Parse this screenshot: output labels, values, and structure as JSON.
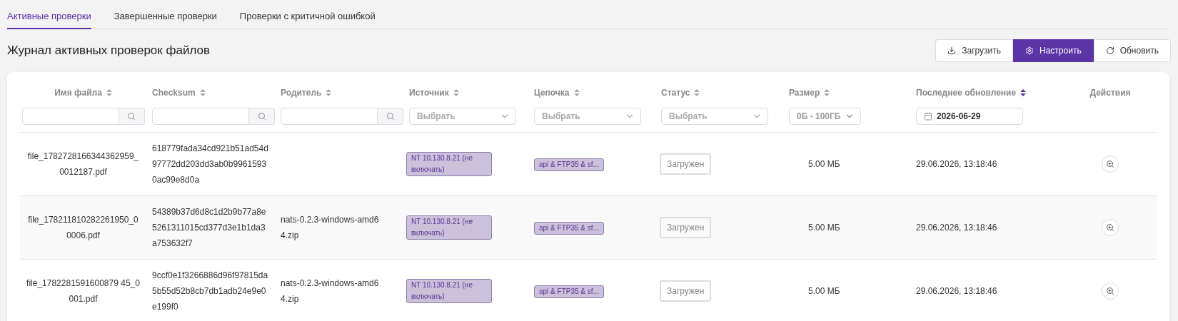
{
  "tabs": [
    {
      "label": "Активные проверки",
      "selected": true
    },
    {
      "label": "Завершенные проверки",
      "selected": false
    },
    {
      "label": "Проверки с критичной ошибкой",
      "selected": false
    }
  ],
  "title": "Журнал активных проверок файлов",
  "buttons": [
    {
      "label": "Загрузить",
      "kind": "download",
      "primary": false
    },
    {
      "label": "Настроить",
      "kind": "settings",
      "primary": true
    },
    {
      "label": "Обновить",
      "kind": "refresh",
      "primary": false
    }
  ],
  "table": {
    "columns": [
      {
        "label": "Имя файла",
        "sorted": false,
        "filter": {
          "kind": "search"
        }
      },
      {
        "label": "Checksum",
        "sorted": false,
        "filter": {
          "kind": "search"
        }
      },
      {
        "label": "Родитель",
        "sorted": false,
        "filter": {
          "kind": "search"
        }
      },
      {
        "label": "Источник",
        "sorted": false,
        "filter": {
          "kind": "select",
          "placeholder": "Выбрать"
        }
      },
      {
        "label": "Цепочка",
        "sorted": false,
        "filter": {
          "kind": "select",
          "placeholder": "Выбрать"
        }
      },
      {
        "label": "Статус",
        "sorted": false,
        "filter": {
          "kind": "select",
          "placeholder": "Выбрать"
        }
      },
      {
        "label": "Размер",
        "sorted": false,
        "filter": {
          "kind": "range",
          "value": "0Б - 100ГБ"
        }
      },
      {
        "label": "Последнее обновление",
        "sorted": true,
        "filter": {
          "kind": "date",
          "value": "2026-06-29"
        }
      },
      {
        "label": "Действия"
      }
    ],
    "rows": [
      {
        "file_name": "file_1782728166344362959_0012187.pdf",
        "checksum": "618779fada34cd921b51ad54d97772dd203dd3ab0b99615930ac99e8d0a",
        "source": "NT 10.130.8.21 (не включать)",
        "chain": "api & FTP35 & sf...",
        "status": "Загружен",
        "size": "5.00 МБ",
        "updated": "29.06.2026, 13:18:46"
      },
      {
        "file_name": "file_178211810282261950_00006.pdf",
        "checksum": "54389b37d6d8c1d2b9b77a8e5261311015cd377d3e1b1da3a753632f7",
        "parent": "nats-0.2.3-windows-amd64.zip",
        "source": "NT 10.130.8.21 (не включать)",
        "chain": "api & FTP35 & sf...",
        "status": "Загружен",
        "size": "5.00 МБ",
        "updated": "29.06.2026, 13:18:46"
      },
      {
        "file_name": "file_1782281591600879 45_0001.pdf",
        "checksum": "9ccf0e1f3266886d96f97815da5b55d52b8cb7db1adb24e9e0e199f0",
        "parent": "nats-0.2.3-windows-amd64.zip",
        "source": "NT 10.130.8.21 (не включать)",
        "chain": "api & FTP35 & sf...",
        "status": "Загружен",
        "size": "5.00 МБ",
        "updated": "29.06.2026, 13:18:46"
      }
    ]
  }
}
